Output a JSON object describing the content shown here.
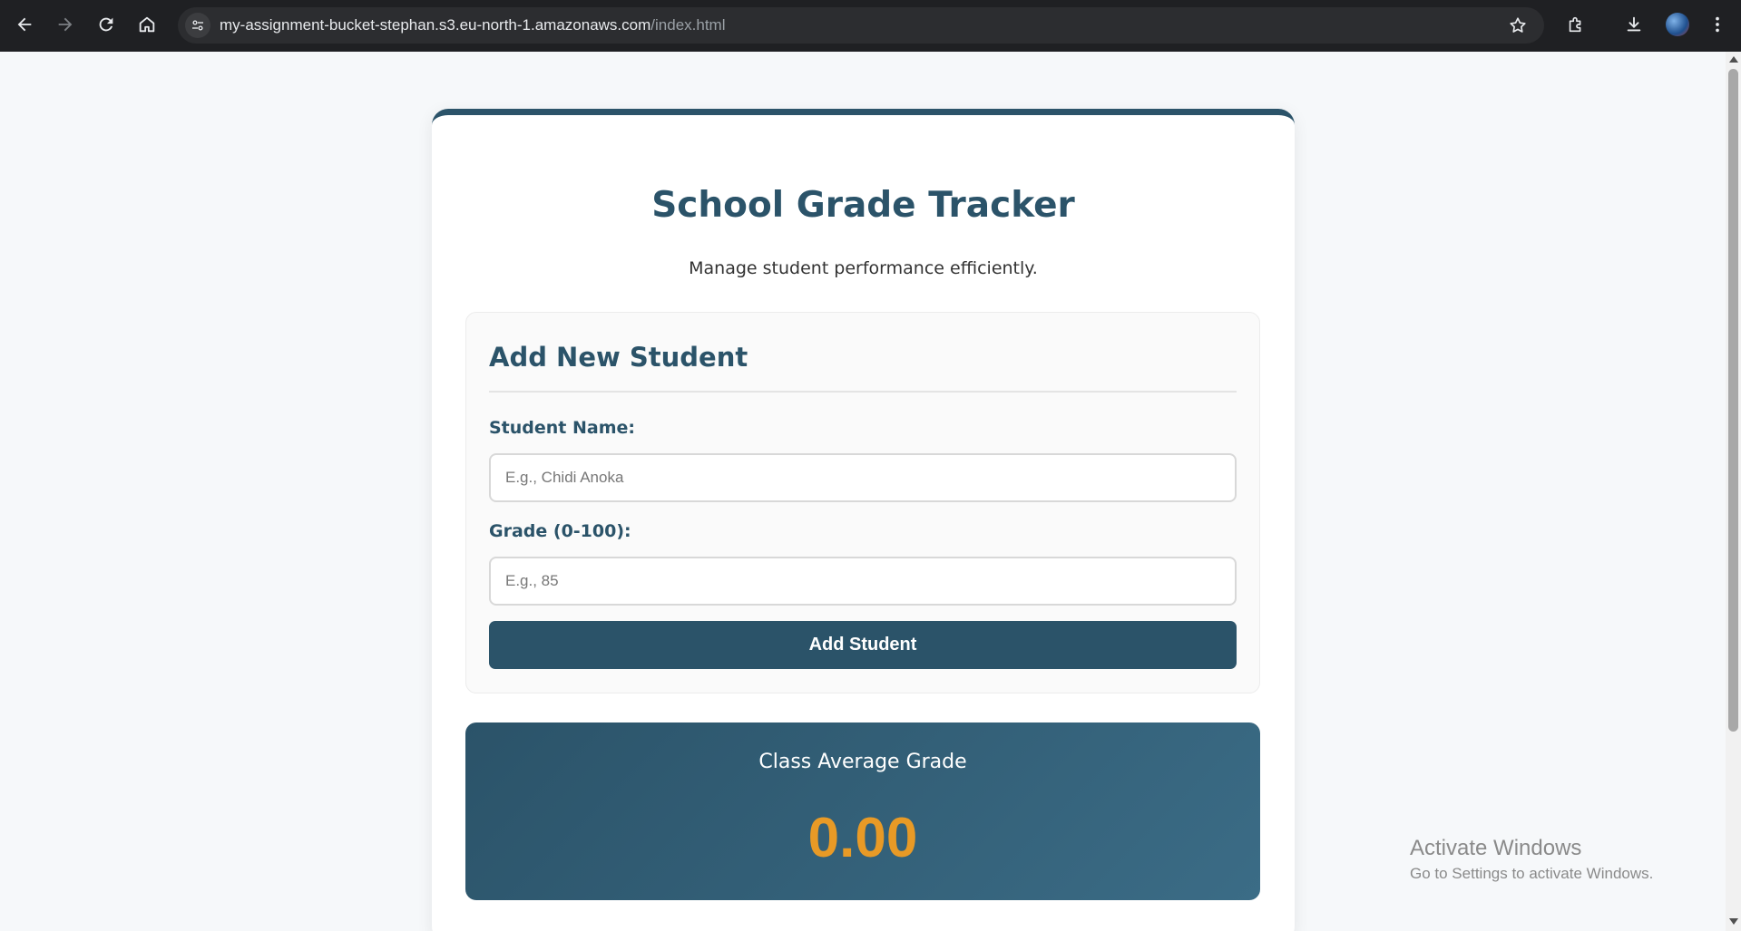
{
  "browser": {
    "url_host": "my-assignment-bucket-stephan.s3.eu-north-1.amazonaws.com",
    "url_path": "/index.html",
    "icons": [
      "back-arrow-icon",
      "forward-arrow-icon",
      "reload-icon",
      "home-icon",
      "site-info-icon",
      "bookmark-star-icon",
      "extensions-icon",
      "download-icon",
      "profile-avatar",
      "menu-kebab-icon"
    ]
  },
  "page": {
    "title": "School Grade Tracker",
    "subtitle": "Manage student performance efficiently."
  },
  "form": {
    "heading": "Add New Student",
    "name_label": "Student Name:",
    "name_placeholder": "E.g., Chidi Anoka",
    "name_value": "",
    "grade_label": "Grade (0-100):",
    "grade_placeholder": "E.g., 85",
    "grade_value": "",
    "submit_label": "Add Student"
  },
  "average": {
    "label": "Class Average Grade",
    "value": "0.00"
  },
  "watermark": {
    "title": "Activate Windows",
    "subtitle": "Go to Settings to activate Windows."
  },
  "colors": {
    "primary": "#2b5369",
    "accent": "#e89a26",
    "background": "#f6f8fa",
    "chrome": "#1f2023"
  }
}
